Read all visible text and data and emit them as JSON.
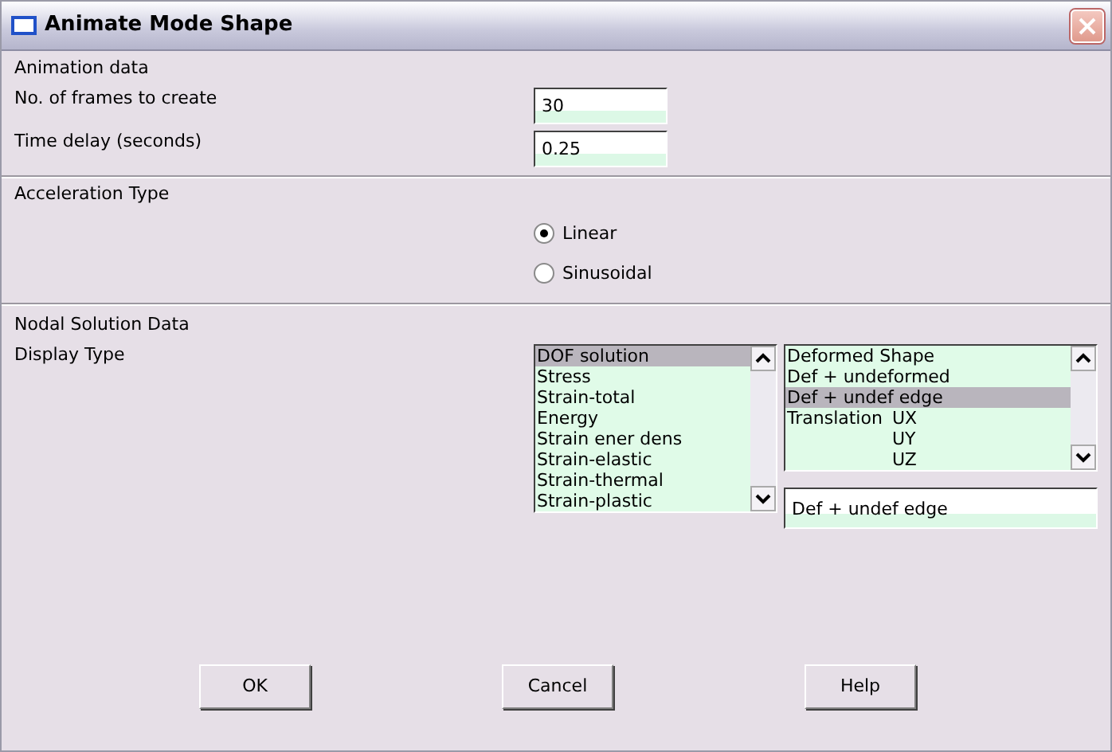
{
  "window": {
    "title": "Animate Mode Shape"
  },
  "animation_data": {
    "heading": "Animation data",
    "fields": [
      {
        "label": "No. of frames to create",
        "value": "30"
      },
      {
        "label": "Time delay (seconds)",
        "value": "0.25"
      }
    ]
  },
  "acceleration": {
    "heading": "Acceleration Type",
    "options": [
      {
        "label": "Linear",
        "selected": true
      },
      {
        "label": "Sinusoidal",
        "selected": false
      }
    ]
  },
  "nodal": {
    "heading": "Nodal Solution Data",
    "label": "Display Type",
    "category_list": {
      "items": [
        {
          "label": "DOF solution",
          "selected": true
        },
        {
          "label": "Stress",
          "selected": false
        },
        {
          "label": "Strain-total",
          "selected": false
        },
        {
          "label": "Energy",
          "selected": false
        },
        {
          "label": "Strain ener dens",
          "selected": false
        },
        {
          "label": "Strain-elastic",
          "selected": false
        },
        {
          "label": "Strain-thermal",
          "selected": false
        },
        {
          "label": "Strain-plastic",
          "selected": false
        }
      ]
    },
    "item_list": {
      "items": [
        {
          "label": "Deformed Shape",
          "selected": false
        },
        {
          "label": "Def + undeformed",
          "selected": false
        },
        {
          "label": "Def + undef edge",
          "selected": true
        },
        {
          "group": "Translation",
          "label": "UX",
          "selected": false
        },
        {
          "label": "UY",
          "selected": false
        },
        {
          "label": "UZ",
          "selected": false
        }
      ]
    },
    "selection_field": {
      "value": "Def + undef edge"
    }
  },
  "buttons": [
    "OK",
    "Cancel",
    "Help"
  ]
}
